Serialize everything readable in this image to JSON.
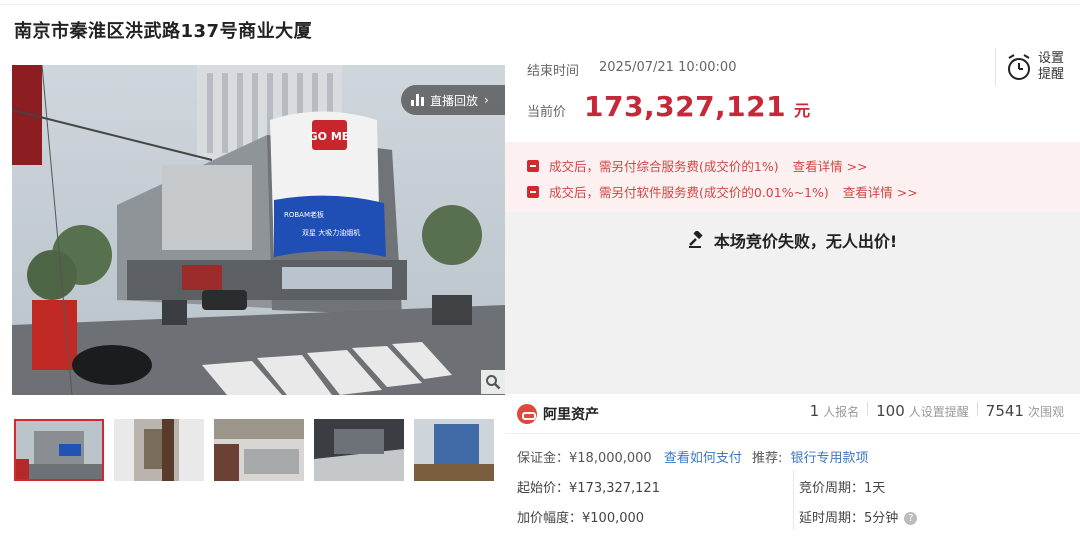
{
  "title": "南京市秦淮区洪武路137号商业大厦",
  "gallery": {
    "live_replay_label": "直播回放",
    "zoom_icon": "magnifier-icon",
    "thumbnails": 5,
    "building_sign": "GO ME",
    "billboard_brand": "ROBAM老板",
    "billboard_text": "双星 大吸力油烟机"
  },
  "auction": {
    "end_time_label": "结束时间",
    "end_time_value": "2025/07/21 10:00:00",
    "price_label": "当前价",
    "price_value": "173,327,121",
    "price_unit": "元",
    "remind_label": "设置提醒",
    "accent_color": "#c6283a"
  },
  "notices": [
    {
      "text": "成交后，需另付综合服务费(成交价的1%)",
      "link": "查看详情 >>"
    },
    {
      "text": "成交后，需另付软件服务费(成交价的0.01%~1%)",
      "link": "查看详情 >>"
    }
  ],
  "fail_message": "本场竞价失败，无人出价!",
  "platform": {
    "name": "阿里资产",
    "signups_num": "1",
    "signups_label": "人报名",
    "reminders_num": "100",
    "reminders_label": "人设置提醒",
    "views_num": "7541",
    "views_label": "次围观"
  },
  "details": {
    "deposit": "保证金：¥18,000,000",
    "how_to_pay": "查看如何支付",
    "recommend_label": "推荐:",
    "recommend_link": "银行专用款项",
    "start_price": "起始价：¥173,327,121",
    "increment": "加价幅度：¥100,000",
    "cycle": "竞价周期：1天",
    "delay": "延时周期：5分钟"
  }
}
